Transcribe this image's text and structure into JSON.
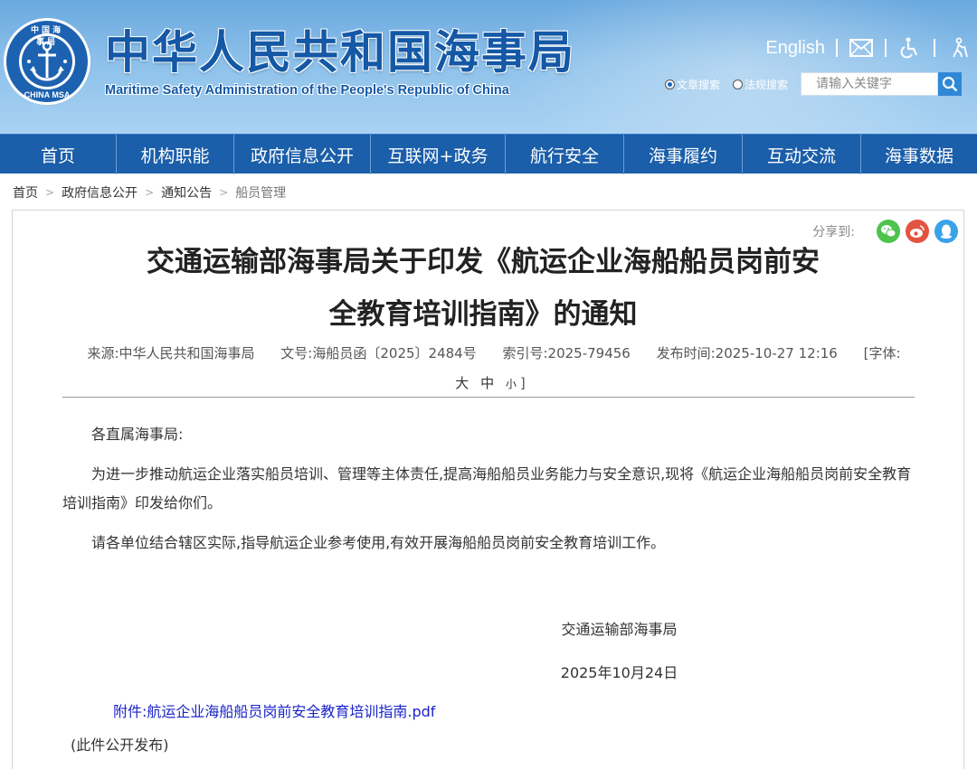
{
  "header": {
    "logo": {
      "top_text": "中国海事局",
      "bottom_text": "CHINA MSA",
      "icon": "anchor-emblem-icon"
    },
    "title": "中华人民共和国海事局",
    "subtitle": "Maritime Safety Administration of the People's Republic of China",
    "links": {
      "english": "English",
      "icons": [
        "mail-icon",
        "accessibility-icon",
        "elder-mode-icon"
      ]
    },
    "search": {
      "options": [
        "文章搜索",
        "法规搜索"
      ],
      "selected": "文章搜索",
      "placeholder": "请输入关键字",
      "button_icon": "search-icon"
    }
  },
  "nav": {
    "items": [
      "首页",
      "机构职能",
      "政府信息公开",
      "互联网+政务",
      "航行安全",
      "海事履约",
      "互动交流",
      "海事数据"
    ]
  },
  "breadcrumb": [
    "首页",
    "政府信息公开",
    "通知公告",
    "船员管理"
  ],
  "article": {
    "share_label": "分享到:",
    "share_icons": [
      "wechat-icon",
      "weibo-icon",
      "qq-icon"
    ],
    "title_line1": "交通运输部海事局关于印发《航运企业海船船员岗前安",
    "title_line2": "全教育培训指南》的通知",
    "meta": {
      "source": "来源:中华人民共和国海事局",
      "doc_no": "文号:海船员函〔2025〕2484号",
      "index_no": "索引号:2025-79456",
      "publish_time": "发布时间:2025-10-27 12:16",
      "font_label_open": "[字体:",
      "font_large": "大",
      "font_medium": "中",
      "font_small": "小",
      "font_label_close": "]"
    },
    "salutation": "各直属海事局:",
    "paragraphs": [
      "为进一步推动航运企业落实船员培训、管理等主体责任,提高海船船员业务能力与安全意识,现将《航运企业海船船员岗前安全教育培训指南》印发给你们。",
      "请各单位结合辖区实际,指导航运企业参考使用,有效开展海船船员岗前安全教育培训工作。"
    ],
    "signature_org": "交通运输部海事局",
    "signature_date": "2025年10月24日",
    "attachment": "附件:航运企业海船船员岗前安全教育培训指南.pdf",
    "publish_note": "(此件公开发布)"
  },
  "colors": {
    "nav_bg": "#1b5ea9",
    "title_blue": "#1458a6",
    "attachment_link": "#1a24c8",
    "wechat": "#4dc34d",
    "weibo": "#e4533f",
    "qq": "#3aa3e8"
  }
}
